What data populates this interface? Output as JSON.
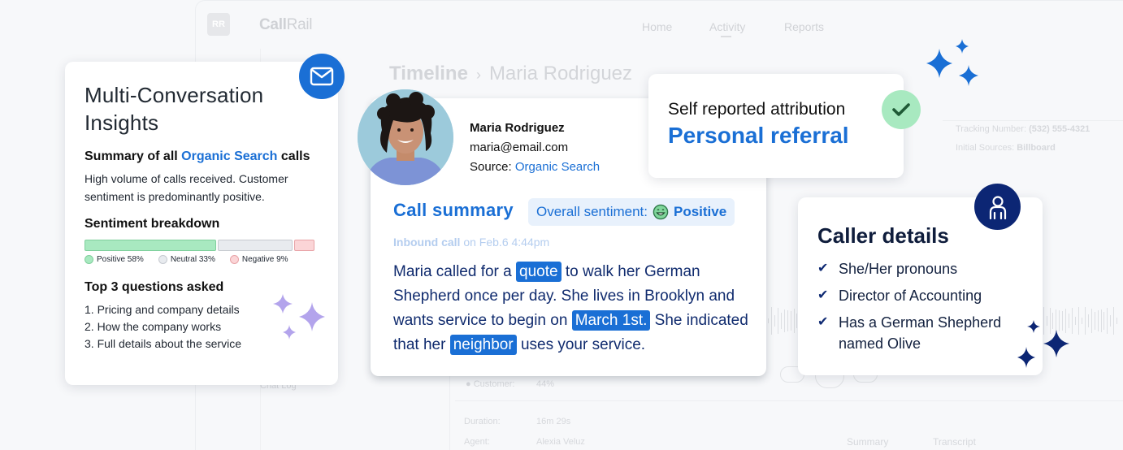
{
  "background_app": {
    "logo_initials": "RR",
    "brand": {
      "bold": "Call",
      "light": "Rail"
    },
    "nav": [
      "Home",
      "Activity",
      "Reports"
    ],
    "breadcrumb": {
      "root": "Timeline",
      "current": "Maria Rodriguez"
    },
    "tracking_number_label": "Tracking Number:",
    "tracking_number": "(532) 555-4321",
    "initial_sources_label": "Initial Sources:",
    "initial_sources": "Billboard",
    "chat_log": "Chat Log",
    "customer_label": "Customer:",
    "customer_value": "44%",
    "duration_label": "Duration:",
    "duration_value": "16m 29s",
    "agent_label": "Agent:",
    "agent_value": "Alexia Veluz",
    "tabs": [
      "Summary",
      "Transcript"
    ]
  },
  "insights_card": {
    "title": "Multi-Conversation Insights",
    "subtitle_prefix": "Summary of all",
    "subtitle_link": "Organic Search",
    "subtitle_suffix": "calls",
    "description": "High volume of calls received. Customer sentiment is predominantly positive.",
    "sentiment_heading": "Sentiment breakdown",
    "sentiment": [
      {
        "label": "Positive 58%",
        "percent": 58,
        "fill": "#a8e9c0",
        "border": "#7fcf9c"
      },
      {
        "label": "Neutral 33%",
        "percent": 33,
        "fill": "#e8ebef",
        "border": "#c6cad0"
      },
      {
        "label": "Negative 9%",
        "percent": 9,
        "fill": "#fbd5d7",
        "border": "#e8a3a7"
      }
    ],
    "questions_heading": "Top 3 questions asked",
    "questions": [
      "1. Pricing and company details",
      "2. How the company works",
      "3. Full details about the service"
    ],
    "icon": "mail-icon"
  },
  "call_card": {
    "name": "Maria Rodriguez",
    "email": "maria@email.com",
    "source_label": "Source:",
    "source_value": "Organic Search",
    "summary_title": "Call summary",
    "sentiment_label": "Overall sentiment:",
    "sentiment_value": "Positive",
    "inbound_label": "Inbound call",
    "inbound_time": "on Feb.6 4:44pm",
    "summary_parts": [
      {
        "text": "Maria called for a ",
        "hl": false
      },
      {
        "text": "quote",
        "hl": true
      },
      {
        "text": " to walk her German Shepherd once per day. She lives in Brooklyn and wants service to begin on ",
        "hl": false
      },
      {
        "text": "March 1st.",
        "hl": true
      },
      {
        "text": " She indicated that her ",
        "hl": false
      },
      {
        "text": "neighbor",
        "hl": true
      },
      {
        "text": " uses your service.",
        "hl": false
      }
    ]
  },
  "attribution_card": {
    "label": "Self reported attribution",
    "value": "Personal referral",
    "icon": "check-icon"
  },
  "caller_card": {
    "title": "Caller details",
    "items": [
      "She/Her pronouns",
      "Director of Accounting",
      "Has a German Shepherd named Olive"
    ],
    "icon": "person-icon"
  },
  "colors": {
    "brand_blue": "#1a6fd5",
    "navy": "#0c2674",
    "sparkle_purple": "#b3a4ec",
    "success_green": "#a8e9c0"
  }
}
